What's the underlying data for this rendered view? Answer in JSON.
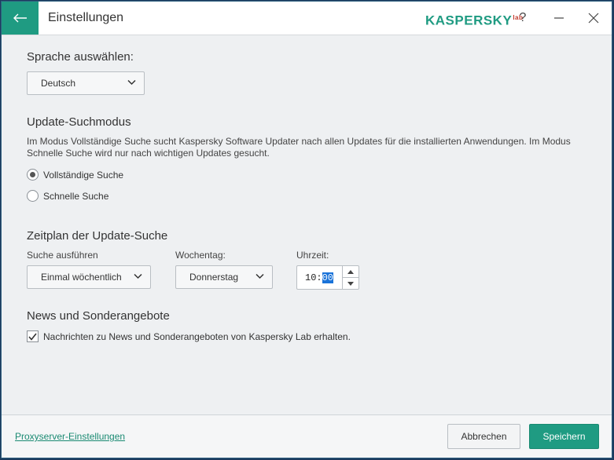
{
  "window": {
    "title": "Einstellungen",
    "brand": "KASPERSKY",
    "brand_mark": "lab",
    "help": "?",
    "accent_color": "#1f9b82"
  },
  "language": {
    "heading": "Sprache auswählen:",
    "selected": "Deutsch"
  },
  "update_mode": {
    "heading": "Update-Suchmodus",
    "description": "Im Modus Vollständige Suche sucht Kaspersky Software Updater nach allen Updates für die installierten Anwendungen. Im Modus Schnelle Suche wird nur nach wichtigen Updates gesucht.",
    "options": [
      {
        "label": "Vollständige Suche",
        "selected": true
      },
      {
        "label": "Schnelle Suche",
        "selected": false
      }
    ]
  },
  "schedule": {
    "heading": "Zeitplan der Update-Suche",
    "run_label": "Suche ausführen",
    "run_value": "Einmal wöchentlich",
    "weekday_label": "Wochentag:",
    "weekday_value": "Donnerstag",
    "time_label": "Uhrzeit:",
    "hour": "10",
    "minute": "00"
  },
  "news": {
    "heading": "News und Sonderangebote",
    "checkbox_label": "Nachrichten zu News und Sonderangeboten von Kaspersky Lab erhalten.",
    "checked": true
  },
  "footer": {
    "proxy_link": "Proxyserver-Einstellungen",
    "cancel_label": "Abbrechen",
    "save_label": "Speichern"
  }
}
